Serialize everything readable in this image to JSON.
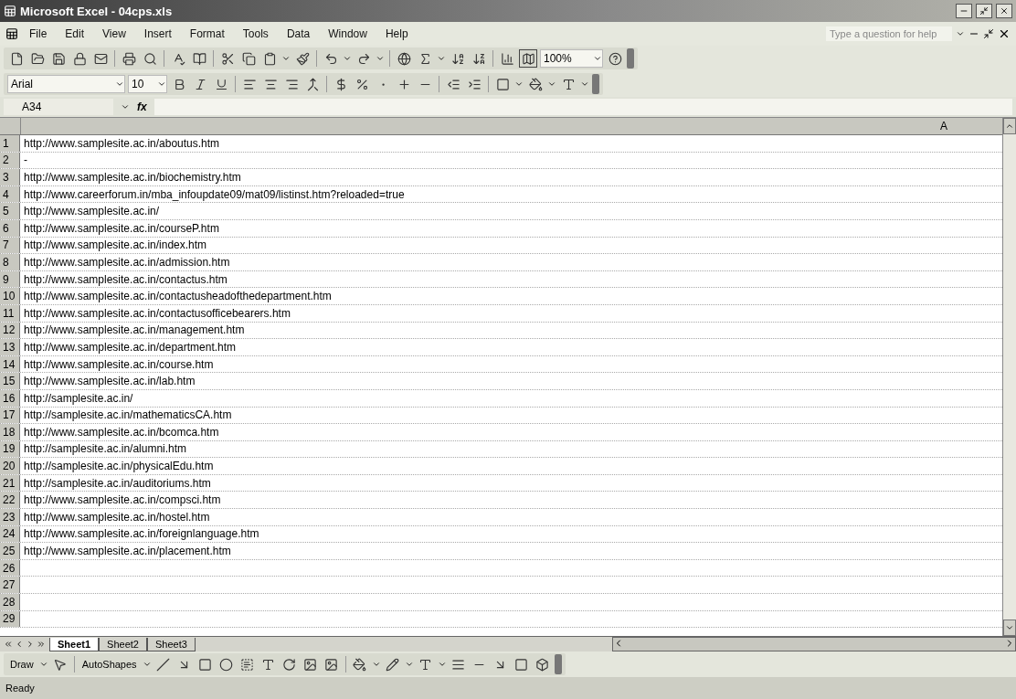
{
  "window": {
    "title": "Microsoft Excel - 04cps.xls"
  },
  "menu": [
    "File",
    "Edit",
    "View",
    "Insert",
    "Format",
    "Tools",
    "Data",
    "Window",
    "Help"
  ],
  "help_box": {
    "placeholder": "Type a question for help"
  },
  "standard_toolbar": {
    "zoom": "100%"
  },
  "formatting_toolbar": {
    "font": "Arial",
    "size": "10"
  },
  "formula_bar": {
    "name_box": "A34",
    "fx": "fx"
  },
  "column_header": "A",
  "rows": [
    {
      "number": "1",
      "cell": "http://www.samplesite.ac.in/aboutus.htm"
    },
    {
      "number": "2",
      "cell": "-"
    },
    {
      "number": "3",
      "cell": "http://www.samplesite.ac.in/biochemistry.htm"
    },
    {
      "number": "4",
      "cell": "http://www.careerforum.in/mba_infoupdate09/mat09/listinst.htm?reloaded=true"
    },
    {
      "number": "5",
      "cell": "http://www.samplesite.ac.in/"
    },
    {
      "number": "6",
      "cell": "http://www.samplesite.ac.in/courseP.htm"
    },
    {
      "number": "7",
      "cell": "http://www.samplesite.ac.in/index.htm"
    },
    {
      "number": "8",
      "cell": "http://www.samplesite.ac.in/admission.htm"
    },
    {
      "number": "9",
      "cell": "http://www.samplesite.ac.in/contactus.htm"
    },
    {
      "number": "10",
      "cell": "http://www.samplesite.ac.in/contactusheadofthedepartment.htm"
    },
    {
      "number": "11",
      "cell": "http://www.samplesite.ac.in/contactusofficebearers.htm"
    },
    {
      "number": "12",
      "cell": "http://www.samplesite.ac.in/management.htm"
    },
    {
      "number": "13",
      "cell": "http://www.samplesite.ac.in/department.htm"
    },
    {
      "number": "14",
      "cell": "http://www.samplesite.ac.in/course.htm"
    },
    {
      "number": "15",
      "cell": "http://www.samplesite.ac.in/lab.htm"
    },
    {
      "number": "16",
      "cell": "http://samplesite.ac.in/"
    },
    {
      "number": "17",
      "cell": "http://samplesite.ac.in/mathematicsCA.htm"
    },
    {
      "number": "18",
      "cell": "http://www.samplesite.ac.in/bcomca.htm"
    },
    {
      "number": "19",
      "cell": "http://samplesite.ac.in/alumni.htm"
    },
    {
      "number": "20",
      "cell": "http://samplesite.ac.in/physicalEdu.htm"
    },
    {
      "number": "21",
      "cell": "http://samplesite.ac.in/auditoriums.htm"
    },
    {
      "number": "22",
      "cell": "http://www.samplesite.ac.in/compsci.htm"
    },
    {
      "number": "23",
      "cell": "http://www.samplesite.ac.in/hostel.htm"
    },
    {
      "number": "24",
      "cell": "http://www.samplesite.ac.in/foreignlanguage.htm"
    },
    {
      "number": "25",
      "cell": "http://www.samplesite.ac.in/placement.htm"
    },
    {
      "number": "26"
    },
    {
      "number": "27"
    },
    {
      "number": "28"
    },
    {
      "number": "29"
    }
  ],
  "sheet_tabs": [
    {
      "label": "Sheet1",
      "selected": true
    },
    {
      "label": "Sheet2",
      "selected": false
    },
    {
      "label": "Sheet3",
      "selected": false
    }
  ],
  "drawing_toolbar": {
    "draw": "Draw",
    "autoshapes": "AutoShapes"
  },
  "status_bar": "Ready"
}
